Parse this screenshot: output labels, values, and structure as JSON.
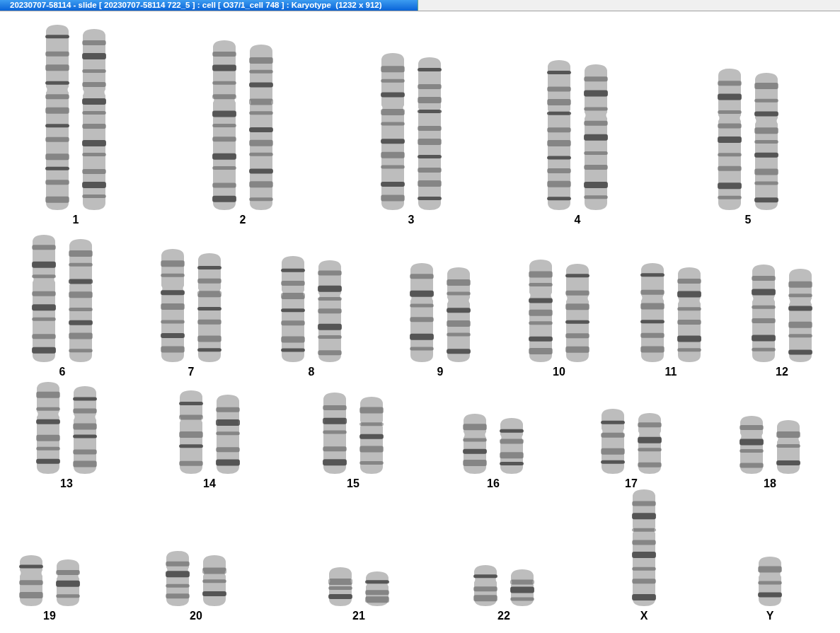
{
  "window": {
    "title": "20230707-58114 - slide [ 20230707-58114 722_5 ] : cell [ O37/1_cell 748 ] : Karyotype  (1232 x 912)"
  },
  "karyotype": {
    "rows": [
      {
        "items": [
          {
            "label": "1",
            "kind": "pair"
          },
          {
            "label": "2",
            "kind": "pair"
          },
          {
            "label": "3",
            "kind": "pair"
          },
          {
            "label": "4",
            "kind": "pair"
          },
          {
            "label": "5",
            "kind": "pair"
          }
        ]
      },
      {
        "items": [
          {
            "label": "6",
            "kind": "pair"
          },
          {
            "label": "7",
            "kind": "pair"
          },
          {
            "label": "8",
            "kind": "pair"
          },
          {
            "label": "9",
            "kind": "pair"
          },
          {
            "label": "10",
            "kind": "pair"
          },
          {
            "label": "11",
            "kind": "pair"
          },
          {
            "label": "12",
            "kind": "pair"
          }
        ]
      },
      {
        "items": [
          {
            "label": "13",
            "kind": "pair"
          },
          {
            "label": "14",
            "kind": "pair"
          },
          {
            "label": "15",
            "kind": "pair"
          },
          {
            "label": "16",
            "kind": "pair"
          },
          {
            "label": "17",
            "kind": "pair"
          },
          {
            "label": "18",
            "kind": "pair"
          }
        ]
      },
      {
        "items": [
          {
            "label": "19",
            "kind": "pair"
          },
          {
            "label": "20",
            "kind": "pair"
          },
          {
            "label": "21",
            "kind": "pair"
          },
          {
            "label": "22",
            "kind": "pair"
          },
          {
            "label": "X",
            "kind": "single"
          },
          {
            "label": "Y",
            "kind": "single"
          }
        ]
      }
    ]
  }
}
